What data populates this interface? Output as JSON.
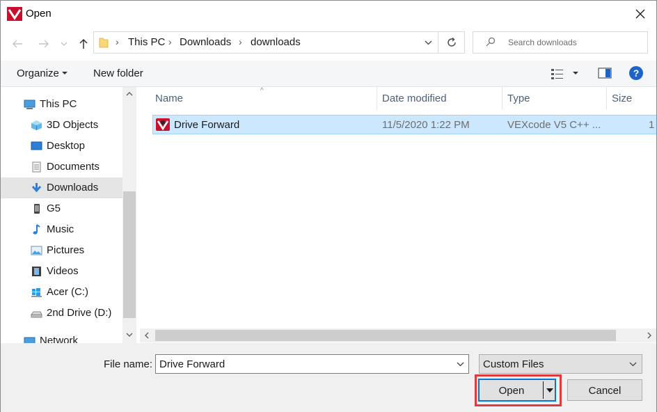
{
  "window": {
    "title": "Open"
  },
  "navigation": {
    "back_icon": "arrow-left-icon",
    "forward_icon": "arrow-right-icon",
    "recent_icon": "chevron-down-icon",
    "up_icon": "arrow-up-icon"
  },
  "address": {
    "breadcrumbs": [
      "This PC",
      "Downloads",
      "downloads"
    ],
    "separator": "›"
  },
  "search": {
    "placeholder": "Search downloads"
  },
  "toolbar": {
    "organize_label": "Organize",
    "new_folder_label": "New folder",
    "help_label": "?"
  },
  "sidebar": {
    "items": [
      {
        "label": "This PC",
        "icon": "computer-icon",
        "selected": false
      },
      {
        "label": "3D Objects",
        "icon": "cube-icon",
        "selected": false
      },
      {
        "label": "Desktop",
        "icon": "desktop-icon",
        "selected": false
      },
      {
        "label": "Documents",
        "icon": "document-icon",
        "selected": false
      },
      {
        "label": "Downloads",
        "icon": "download-arrow-icon",
        "selected": true
      },
      {
        "label": "G5",
        "icon": "phone-icon",
        "selected": false
      },
      {
        "label": "Music",
        "icon": "music-note-icon",
        "selected": false
      },
      {
        "label": "Pictures",
        "icon": "picture-icon",
        "selected": false
      },
      {
        "label": "Videos",
        "icon": "film-icon",
        "selected": false
      },
      {
        "label": "Acer (C:)",
        "icon": "windows-drive-icon",
        "selected": false
      },
      {
        "label": "2nd Drive (D:)",
        "icon": "drive-icon",
        "selected": false
      },
      {
        "label": "Network",
        "icon": "network-icon",
        "selected": false
      }
    ]
  },
  "file_list": {
    "columns": [
      "Name",
      "Date modified",
      "Type",
      "Size"
    ],
    "rows": [
      {
        "name": "Drive Forward",
        "date_modified": "11/5/2020 1:22 PM",
        "type": "VEXcode V5 C++ ...",
        "size": "1",
        "icon": "vexcode-icon",
        "selected": true
      }
    ]
  },
  "footer": {
    "file_name_label": "File name:",
    "file_name_value": "Drive Forward",
    "file_type_value": "Custom Files",
    "open_label": "Open",
    "cancel_label": "Cancel"
  },
  "colors": {
    "selection_bg": "#cce8ff",
    "selection_border": "#99d1ff",
    "focus_border": "#0078d7",
    "highlight_box": "#e03a3e",
    "brand_red": "#c8102e"
  }
}
